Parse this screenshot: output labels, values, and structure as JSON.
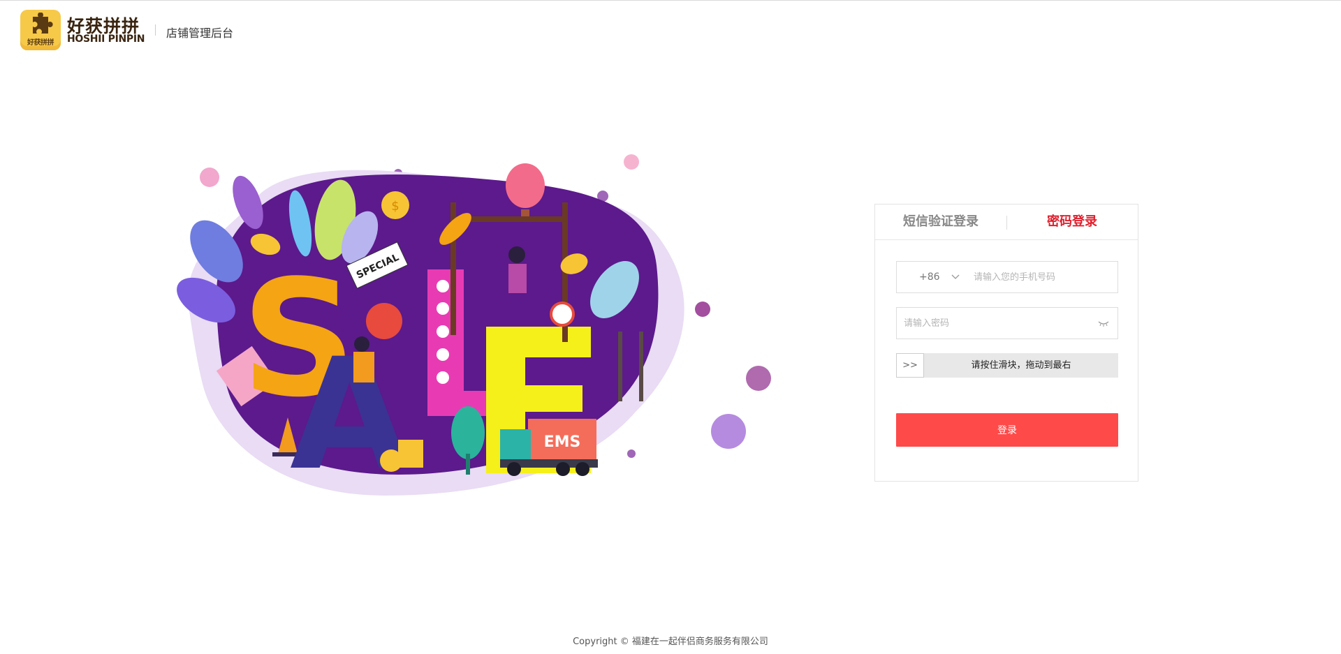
{
  "header": {
    "logo_badge_text": "好获拼拼",
    "logo_cn": "好获拼拼",
    "logo_en": "HOSHII PINPIN",
    "subtitle": "店铺管理后台"
  },
  "illustration": {
    "letters": [
      "S",
      "A",
      "L",
      "E"
    ],
    "tag_text": "SPECIAL",
    "truck_text": "EMS",
    "coin_symbol": "$"
  },
  "login": {
    "tabs": [
      {
        "label": "短信验证登录",
        "active": false
      },
      {
        "label": "密码登录",
        "active": true
      }
    ],
    "phone": {
      "country_code": "+86",
      "placeholder": "请输入您的手机号码",
      "value": ""
    },
    "password": {
      "placeholder": "请输入密码",
      "value": ""
    },
    "slider": {
      "handle_label": ">>",
      "hint": "请按住滑块，拖动到最右"
    },
    "submit_label": "登录"
  },
  "footer": {
    "copyright": "Copyright © 福建在一起伴侣商务服务有限公司"
  },
  "colors": {
    "accent_red": "#e0202e",
    "button_red": "#ff4a4a",
    "logo_yellow": "#f7c948",
    "illustration_purple": "#5c1a8c"
  }
}
